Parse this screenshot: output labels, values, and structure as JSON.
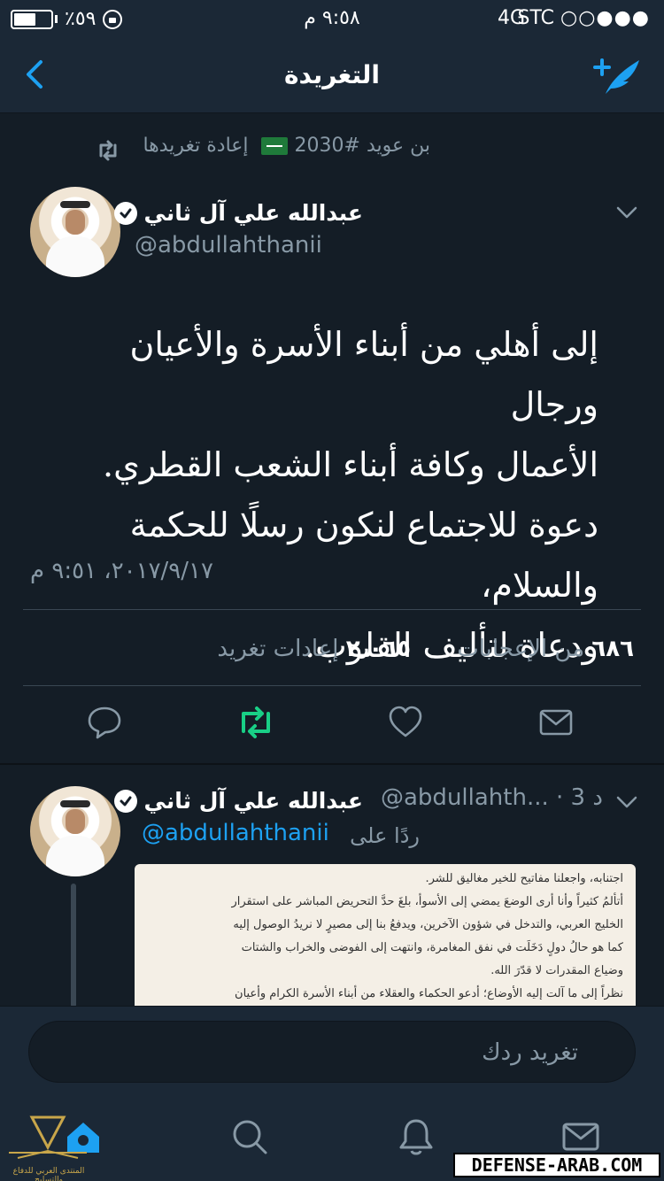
{
  "status_bar": {
    "carrier": "STC",
    "signal_dots": "○○●●●",
    "network": "4G",
    "time": "٩:٥٨ م",
    "battery": "٪٥٩",
    "battery_level": 0.59
  },
  "nav": {
    "title": "التغريدة",
    "back_icon": "chevron-left-icon",
    "compose_icon": "compose-tweet-icon"
  },
  "retweet_context": {
    "text": "بن عويد #2030",
    "label": "إعادة تغريدها"
  },
  "tweet": {
    "author_name": "عبدالله علي آل ثاني",
    "author_handle": "@abdullahthanii",
    "text": "إلى أهلي من أبناء الأسرة والأعيان ورجال\nالأعمال وكافة أبناء الشعب القطري.\nدعوة للاجتماع لنكون رسلًا للحكمة والسلام،\nودعاة لتأليف القلوب.",
    "timestamp": "٢٠١٧/٩/١٧، ٩:٥١ م",
    "retweets_count": "٢٫٠٦٥",
    "retweets_label": "إعادات تغريد",
    "likes_count": "٦٨٦",
    "likes_label": "من الإعجابات"
  },
  "reply": {
    "author_name": "عبدالله علي آل ثاني",
    "author_handle": "@abdullahth... · 3 د",
    "replying_label": "ردًا على",
    "replying_to": "@abdullahthanii",
    "media_lines": [
      "اجتنابه، واجعلنا مفاتيح للخير مغاليق للشر.",
      "أتألمُ كثيراً وأنا أرى الوضعَ يمضي إلى الأسوأ، بلغَ حدَّ التحريض المباشر على استقرار",
      "الخليج العربي، والتدخل في شؤون الآخرين، ويدفعُ بنا إلى مصيرٍ لا نريدُ الوصول إليه",
      "كما هو حالُ دولٍ دَخَلَت في نفق المغامرة، وانتهت إلى الفوضى والخراب والشتات",
      "وضياع المقدرات لا قدّرَ الله.",
      "نظراً إلى ما آلت إليه الأوضاع؛ أدعو الحكماء والعقلاء من أبناء الأسرة الكرام وأعيان"
    ]
  },
  "composer": {
    "placeholder": "تغريد ردك"
  },
  "tabs": [
    {
      "name": "home-icon"
    },
    {
      "name": "search-icon"
    },
    {
      "name": "notifications-icon"
    },
    {
      "name": "messages-icon"
    }
  ],
  "watermark": {
    "right_text": "DEFENSE-ARAB.COM",
    "left_text": "المنتدى العربي للدفاع والتسليح"
  },
  "colors": {
    "background": "#141d26",
    "bar": "#1b2836",
    "accent": "#1da1f2",
    "retweeted": "#19cf86",
    "muted": "#8899a6"
  }
}
